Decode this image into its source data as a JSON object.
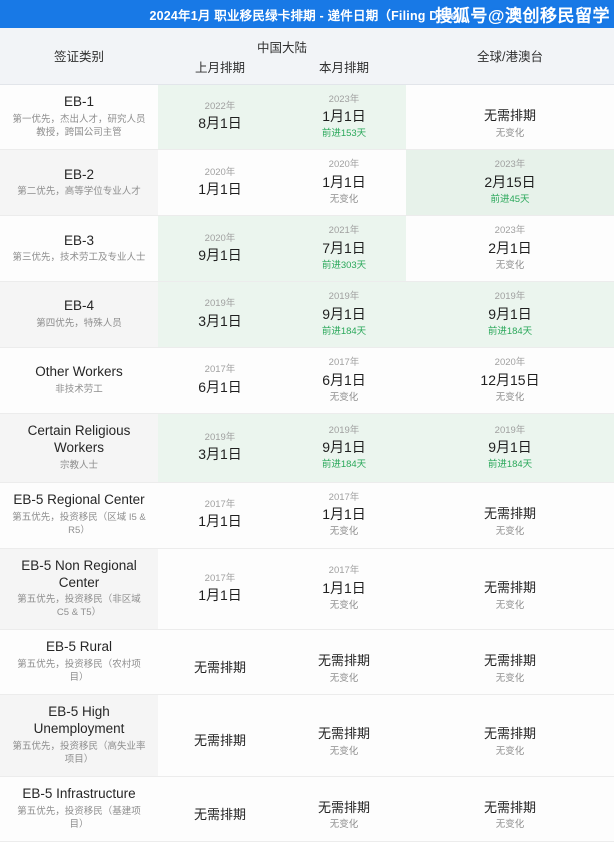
{
  "header": {
    "title": "2024年1月 职业移民绿卡排期 - 递件日期（Filing Date /",
    "watermark": "搜狐号@澳创移民留学",
    "bar_color": "#1879e6"
  },
  "colors": {
    "advance_green": "#2aa85a",
    "highlight_green": "#e7f2ea",
    "shade_grey": "#f5f5f5"
  },
  "table": {
    "columns": {
      "category": "签证类别",
      "china_group": "中国大陆",
      "china_prev": "上月排期",
      "china_cur": "本月排期",
      "global": "全球/港澳台"
    },
    "rows": [
      {
        "name": "EB-1",
        "desc": "第一优先，杰出人才，研究人员教授，跨国公司主管",
        "cat_shade": "white",
        "prev": {
          "year": "2022年",
          "day": "8月1日",
          "note": "",
          "shade": "green-light"
        },
        "cur": {
          "year": "2023年",
          "day": "1月1日",
          "note": "前进153天",
          "note_type": "adv",
          "shade": "green-light"
        },
        "glob": {
          "year": "",
          "day": "无需排期",
          "note": "无变化",
          "note_type": "same",
          "shade": "white"
        }
      },
      {
        "name": "EB-2",
        "desc": "第二优先，高等学位专业人才",
        "cat_shade": "grey",
        "prev": {
          "year": "2020年",
          "day": "1月1日",
          "note": "",
          "shade": "white"
        },
        "cur": {
          "year": "2020年",
          "day": "1月1日",
          "note": "无变化",
          "note_type": "same",
          "shade": "white"
        },
        "glob": {
          "year": "2023年",
          "day": "2月15日",
          "note": "前进45天",
          "note_type": "adv",
          "shade": "green"
        }
      },
      {
        "name": "EB-3",
        "desc": "第三优先，技术劳工及专业人士",
        "cat_shade": "white",
        "prev": {
          "year": "2020年",
          "day": "9月1日",
          "note": "",
          "shade": "green-light"
        },
        "cur": {
          "year": "2021年",
          "day": "7月1日",
          "note": "前进303天",
          "note_type": "adv",
          "shade": "green-light"
        },
        "glob": {
          "year": "2023年",
          "day": "2月1日",
          "note": "无变化",
          "note_type": "same",
          "shade": "white"
        }
      },
      {
        "name": "EB-4",
        "desc": "第四优先，特殊人员",
        "cat_shade": "grey",
        "prev": {
          "year": "2019年",
          "day": "3月1日",
          "note": "",
          "shade": "green-light"
        },
        "cur": {
          "year": "2019年",
          "day": "9月1日",
          "note": "前进184天",
          "note_type": "adv",
          "shade": "green-light"
        },
        "glob": {
          "year": "2019年",
          "day": "9月1日",
          "note": "前进184天",
          "note_type": "adv",
          "shade": "green-light"
        }
      },
      {
        "name": "Other Workers",
        "desc": "非技术劳工",
        "cat_shade": "white",
        "prev": {
          "year": "2017年",
          "day": "6月1日",
          "note": "",
          "shade": "white"
        },
        "cur": {
          "year": "2017年",
          "day": "6月1日",
          "note": "无变化",
          "note_type": "same",
          "shade": "white"
        },
        "glob": {
          "year": "2020年",
          "day": "12月15日",
          "note": "无变化",
          "note_type": "same",
          "shade": "white"
        }
      },
      {
        "name": "Certain Religious Workers",
        "desc": "宗教人士",
        "cat_shade": "grey",
        "prev": {
          "year": "2019年",
          "day": "3月1日",
          "note": "",
          "shade": "green-light"
        },
        "cur": {
          "year": "2019年",
          "day": "9月1日",
          "note": "前进184天",
          "note_type": "adv",
          "shade": "green-light"
        },
        "glob": {
          "year": "2019年",
          "day": "9月1日",
          "note": "前进184天",
          "note_type": "adv",
          "shade": "green-light"
        }
      },
      {
        "name": "EB-5 Regional Center",
        "desc": "第五优先，投资移民（区域 I5 & R5）",
        "cat_shade": "white",
        "prev": {
          "year": "2017年",
          "day": "1月1日",
          "note": "",
          "shade": "white"
        },
        "cur": {
          "year": "2017年",
          "day": "1月1日",
          "note": "无变化",
          "note_type": "same",
          "shade": "white"
        },
        "glob": {
          "year": "",
          "day": "无需排期",
          "note": "无变化",
          "note_type": "same",
          "shade": "white"
        }
      },
      {
        "name": "EB-5 Non Regional Center",
        "desc": "第五优先，投资移民（非区域 C5 & T5）",
        "cat_shade": "grey",
        "prev": {
          "year": "2017年",
          "day": "1月1日",
          "note": "",
          "shade": "white"
        },
        "cur": {
          "year": "2017年",
          "day": "1月1日",
          "note": "无变化",
          "note_type": "same",
          "shade": "white"
        },
        "glob": {
          "year": "",
          "day": "无需排期",
          "note": "无变化",
          "note_type": "same",
          "shade": "white"
        }
      },
      {
        "name": "EB-5 Rural",
        "desc": "第五优先，投资移民（农村项目）",
        "cat_shade": "white",
        "prev": {
          "year": "",
          "day": "无需排期",
          "note": "",
          "shade": "white"
        },
        "cur": {
          "year": "",
          "day": "无需排期",
          "note": "无变化",
          "note_type": "same",
          "shade": "white"
        },
        "glob": {
          "year": "",
          "day": "无需排期",
          "note": "无变化",
          "note_type": "same",
          "shade": "white"
        }
      },
      {
        "name": "EB-5 High Unemployment",
        "desc": "第五优先，投资移民（高失业率项目）",
        "cat_shade": "grey",
        "prev": {
          "year": "",
          "day": "无需排期",
          "note": "",
          "shade": "white"
        },
        "cur": {
          "year": "",
          "day": "无需排期",
          "note": "无变化",
          "note_type": "same",
          "shade": "white"
        },
        "glob": {
          "year": "",
          "day": "无需排期",
          "note": "无变化",
          "note_type": "same",
          "shade": "white"
        }
      },
      {
        "name": "EB-5 Infrastructure",
        "desc": "第五优先，投资移民（基建项目）",
        "cat_shade": "white",
        "prev": {
          "year": "",
          "day": "无需排期",
          "note": "",
          "shade": "white"
        },
        "cur": {
          "year": "",
          "day": "无需排期",
          "note": "无变化",
          "note_type": "same",
          "shade": "white"
        },
        "glob": {
          "year": "",
          "day": "无需排期",
          "note": "无变化",
          "note_type": "same",
          "shade": "white"
        }
      }
    ]
  }
}
